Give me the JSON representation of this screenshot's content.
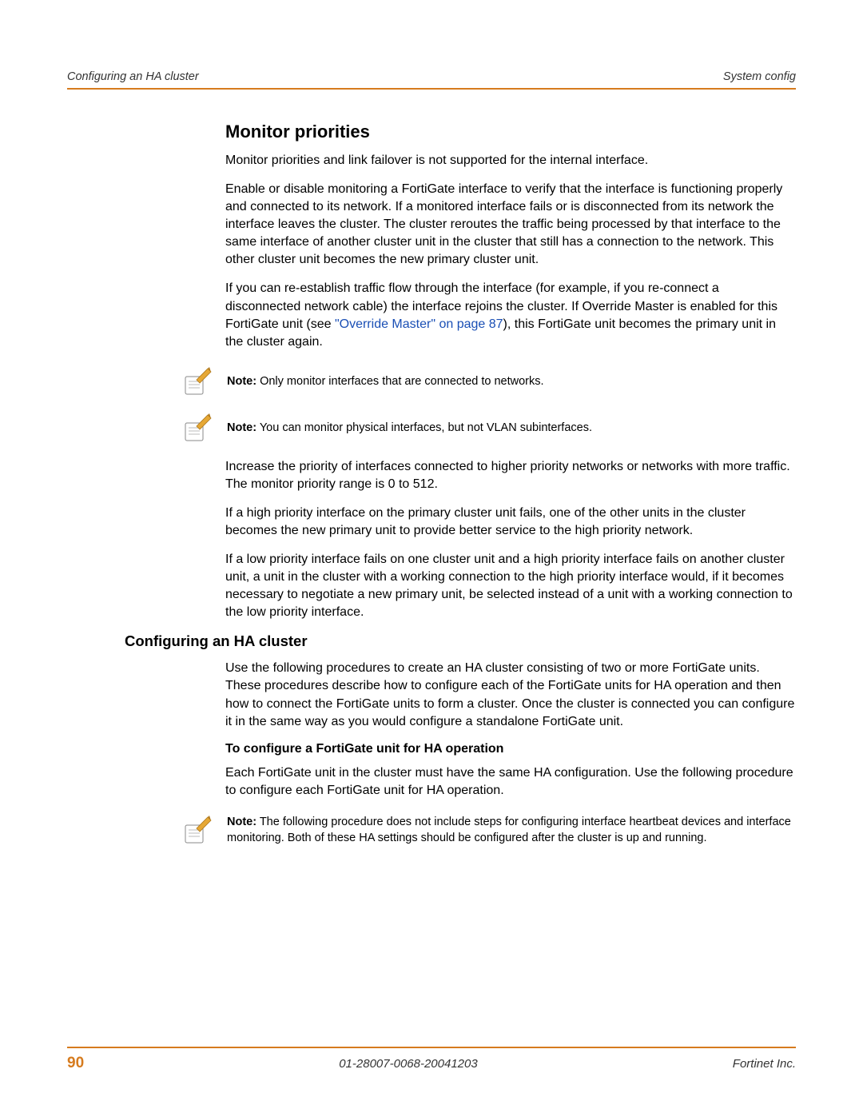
{
  "header": {
    "left": "Configuring an HA cluster",
    "right": "System config"
  },
  "section1": {
    "heading": "Monitor priorities",
    "p1": "Monitor priorities and link failover is not supported for the internal interface.",
    "p2": "Enable or disable monitoring a FortiGate interface to verify that the interface is functioning properly and connected to its network. If a monitored interface fails or is disconnected from its network the interface leaves the cluster. The cluster reroutes the traffic being processed by that interface to the same interface of another cluster unit in the cluster that still has a connection to the network. This other cluster unit becomes the new primary cluster unit.",
    "p3a": "If you can re-establish traffic flow through the interface (for example, if you re-connect a disconnected network cable) the interface rejoins the cluster. If Override Master is enabled for this FortiGate unit (see ",
    "p3_link": "\"Override Master\" on page 87",
    "p3b": "), this FortiGate unit becomes the primary unit in the cluster again.",
    "note1_label": "Note:",
    "note1_text": " Only monitor interfaces that are connected to networks.",
    "note2_label": "Note:",
    "note2_text": " You can monitor physical interfaces, but not VLAN subinterfaces.",
    "p4": "Increase the priority of interfaces connected to higher priority networks or networks with more traffic. The monitor priority range is 0 to 512.",
    "p5": "If a high priority interface on the primary cluster unit fails, one of the other units in the cluster becomes the new primary unit to provide better service to the high priority network.",
    "p6": "If a low priority interface fails on one cluster unit and a high priority interface fails on another cluster unit, a unit in the cluster with a working connection to the high priority interface would, if it becomes necessary to negotiate a new primary unit, be selected instead of a unit with a working connection to the low priority interface."
  },
  "section2": {
    "heading": "Configuring an HA cluster",
    "p1": "Use the following procedures to create an HA cluster consisting of two or more FortiGate units. These procedures describe how to configure each of the FortiGate units for HA operation and then how to connect the FortiGate units to form a cluster. Once the cluster is connected you can configure it in the same way as you would configure a standalone FortiGate unit.",
    "proc_heading": "To configure a FortiGate unit for HA operation",
    "p2": "Each FortiGate unit in the cluster must have the same HA configuration. Use the following procedure to configure each FortiGate unit for HA operation.",
    "note3_label": "Note:",
    "note3_text": " The following procedure does not include steps for configuring interface heartbeat devices and interface monitoring. Both of these HA settings should be configured after the cluster is up and running."
  },
  "footer": {
    "page_num": "90",
    "doc_id": "01-28007-0068-20041203",
    "company": "Fortinet Inc."
  }
}
